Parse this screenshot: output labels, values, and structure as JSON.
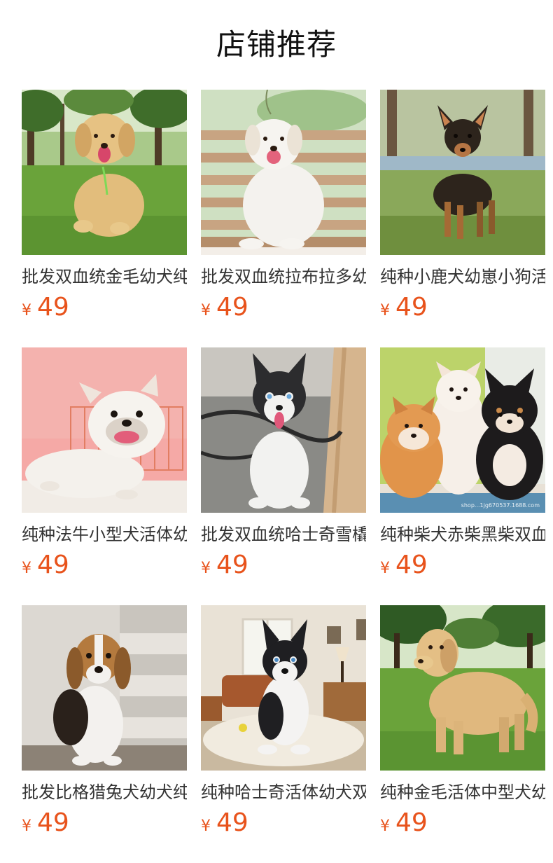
{
  "page": {
    "title": "店铺推荐"
  },
  "currency_symbol": "¥",
  "colors": {
    "price": "#e8531c",
    "title": "#111111",
    "text": "#333333"
  },
  "products": [
    {
      "name": "批发双血统金毛幼犬纯种",
      "price": "49",
      "image": "golden-retriever-puppy-on-grass-photo"
    },
    {
      "name": "批发双血统拉布拉多幼犬",
      "price": "49",
      "image": "white-labrador-puppy-bench-photo"
    },
    {
      "name": "纯种小鹿犬幼崽小狗活体",
      "price": "49",
      "image": "miniature-pinscher-puppy-photo"
    },
    {
      "name": "纯种法牛小型犬活体幼犬",
      "price": "49",
      "image": "french-bulldog-puppy-photo"
    },
    {
      "name": "批发双血统哈士奇雪橇犬",
      "price": "49",
      "image": "husky-puppy-indoor-photo"
    },
    {
      "name": "纯种柴犬赤柴黑柴双血统",
      "price": "49",
      "image": "three-shiba-puppies-photo",
      "watermark": "shop...1jg670537.1688.com"
    },
    {
      "name": "批发比格猎兔犬幼犬纯种",
      "price": "49",
      "image": "beagle-puppy-stairs-photo"
    },
    {
      "name": "纯种哈士奇活体幼犬双血统",
      "price": "49",
      "image": "husky-puppy-living-room-photo"
    },
    {
      "name": "纯种金毛活体中型犬幼犬",
      "price": "49",
      "image": "golden-retriever-dog-park-photo"
    }
  ]
}
